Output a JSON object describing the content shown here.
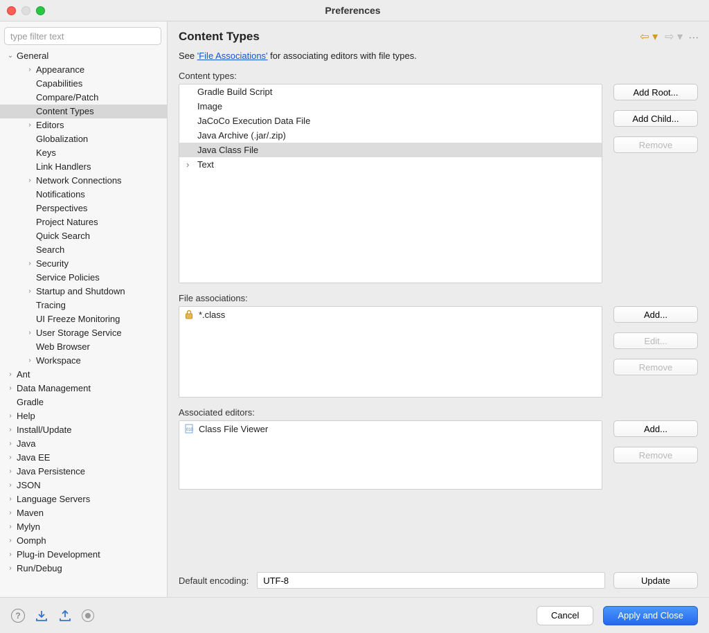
{
  "window": {
    "title": "Preferences"
  },
  "sidebar": {
    "filter_placeholder": "type filter text",
    "general": {
      "label": "General",
      "children": {
        "appearance": "Appearance",
        "capabilities": "Capabilities",
        "compare_patch": "Compare/Patch",
        "content_types": "Content Types",
        "editors": "Editors",
        "globalization": "Globalization",
        "keys": "Keys",
        "link_handlers": "Link Handlers",
        "network": "Network Connections",
        "notifications": "Notifications",
        "perspectives": "Perspectives",
        "project_natures": "Project Natures",
        "quick_search": "Quick Search",
        "search": "Search",
        "security": "Security",
        "service_policies": "Service Policies",
        "startup": "Startup and Shutdown",
        "tracing": "Tracing",
        "ui_freeze": "UI Freeze Monitoring",
        "user_storage": "User Storage Service",
        "web_browser": "Web Browser",
        "workspace": "Workspace"
      }
    },
    "others": {
      "ant": "Ant",
      "data_management": "Data Management",
      "gradle": "Gradle",
      "help": "Help",
      "install_update": "Install/Update",
      "java": "Java",
      "java_ee": "Java EE",
      "java_persistence": "Java Persistence",
      "json": "JSON",
      "language_servers": "Language Servers",
      "maven": "Maven",
      "mylyn": "Mylyn",
      "oomph": "Oomph",
      "plugin_dev": "Plug-in Development",
      "run_debug": "Run/Debug"
    }
  },
  "content": {
    "title": "Content Types",
    "intro_prefix": "See ",
    "intro_link": "'File Associations'",
    "intro_suffix": " for associating editors with file types.",
    "ct_label": "Content types:",
    "ct_items": {
      "gradle": "Gradle Build Script",
      "image": "Image",
      "jacoco": "JaCoCo Execution Data File",
      "archive": "Java Archive (.jar/.zip)",
      "classfile": "Java Class File",
      "text": "Text"
    },
    "ct_buttons": {
      "add_root": "Add Root...",
      "add_child": "Add Child...",
      "remove": "Remove"
    },
    "fa_label": "File associations:",
    "fa_items": {
      "class": "*.class"
    },
    "fa_buttons": {
      "add": "Add...",
      "edit": "Edit...",
      "remove": "Remove"
    },
    "ed_label": "Associated editors:",
    "ed_items": {
      "viewer": "Class File Viewer"
    },
    "ed_buttons": {
      "add": "Add...",
      "remove": "Remove"
    },
    "encoding": {
      "label": "Default encoding:",
      "value": "UTF-8",
      "update": "Update"
    }
  },
  "footer": {
    "cancel": "Cancel",
    "apply_close": "Apply and Close"
  }
}
